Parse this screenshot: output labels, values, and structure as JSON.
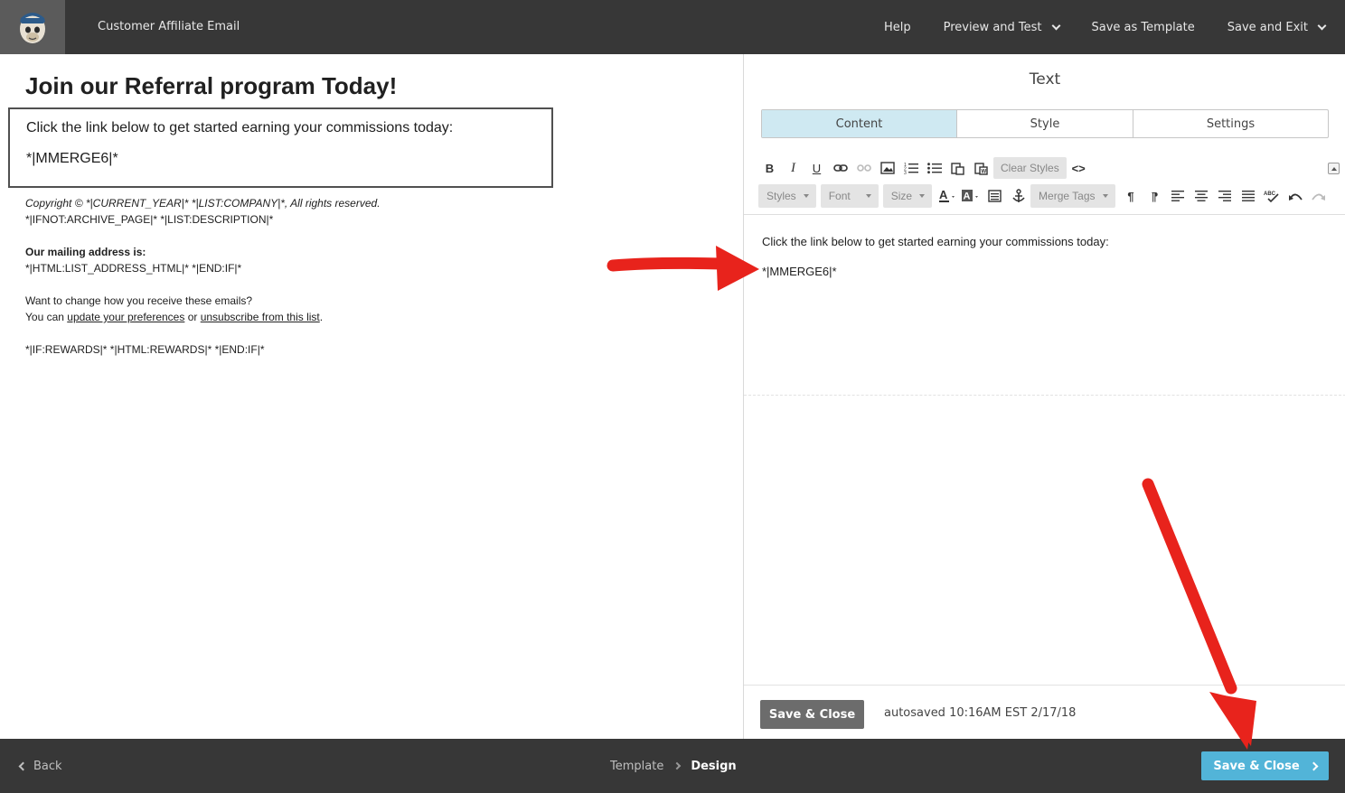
{
  "topbar": {
    "title": "Customer Affiliate Email",
    "help": "Help",
    "preview_test": "Preview and Test",
    "save_template": "Save as Template",
    "save_exit": "Save and Exit"
  },
  "preview": {
    "heading": "Join our Referral program Today!",
    "block_line1": "Click the link below to get started earning your commissions today:",
    "block_line2": "*|MMERGE6|*",
    "copyright": "Copyright © *|CURRENT_YEAR|* *|LIST:COMPANY|*, All rights reserved.",
    "archive_line": "*|IFNOT:ARCHIVE_PAGE|* *|LIST:DESCRIPTION|*",
    "mailing_label": "Our mailing address is:",
    "address_line": "*|HTML:LIST_ADDRESS_HTML|* *|END:IF|*",
    "change_q": "Want to change how you receive these emails?",
    "you_can": "You can ",
    "update_prefs": "update your preferences",
    "or": " or ",
    "unsubscribe": "unsubscribe from this list",
    "period": ".",
    "rewards_line": "*|IF:REWARDS|* *|HTML:REWARDS|* *|END:IF|*"
  },
  "editor": {
    "title": "Text",
    "tabs": [
      "Content",
      "Style",
      "Settings"
    ],
    "toolbar": {
      "clear_styles": "Clear Styles",
      "styles": "Styles",
      "font": "Font",
      "size": "Size",
      "merge_tags": "Merge Tags"
    },
    "content_line1": "Click the link below to get started earning your commissions today:",
    "content_line2": "*|MMERGE6|*",
    "save_close": "Save & Close",
    "autosaved": "autosaved 10:16AM EST 2/17/18"
  },
  "bottombar": {
    "back": "Back",
    "crumb_template": "Template",
    "crumb_design": "Design",
    "save_close": "Save & Close"
  },
  "colors": {
    "topbar": "#373737",
    "active_tab": "#cfe9f2",
    "primary_button": "#52b4d8",
    "annotation_arrow": "#e8231c"
  }
}
